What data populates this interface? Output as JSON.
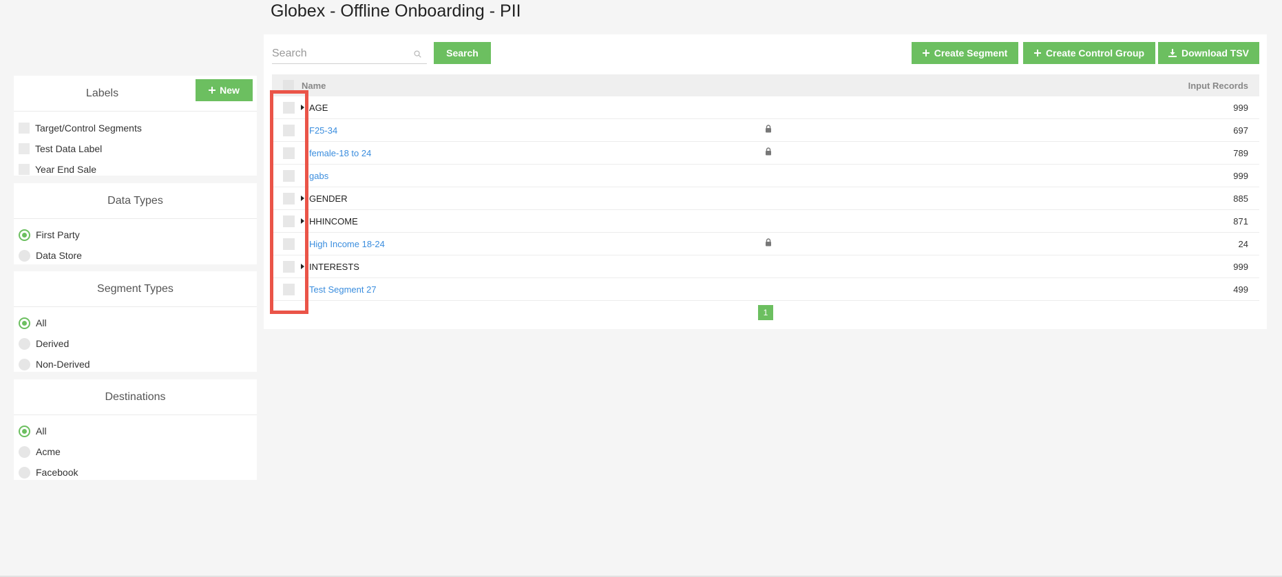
{
  "page": {
    "title": "Globex - Offline Onboarding - PII"
  },
  "labels_panel": {
    "title": "Labels",
    "new_button": "New",
    "items": [
      "Target/Control Segments",
      "Test Data Label",
      "Year End Sale"
    ]
  },
  "data_types_panel": {
    "title": "Data Types",
    "options": [
      {
        "label": "First Party",
        "selected": true
      },
      {
        "label": "Data Store",
        "selected": false
      }
    ]
  },
  "segment_types_panel": {
    "title": "Segment Types",
    "options": [
      {
        "label": "All",
        "selected": true
      },
      {
        "label": "Derived",
        "selected": false
      },
      {
        "label": "Non-Derived",
        "selected": false
      }
    ]
  },
  "destinations_panel": {
    "title": "Destinations",
    "options": [
      {
        "label": "All",
        "selected": true
      },
      {
        "label": "Acme",
        "selected": false
      },
      {
        "label": "Facebook",
        "selected": false
      }
    ]
  },
  "toolbar": {
    "search_placeholder": "Search",
    "search_button": "Search",
    "create_segment": "Create Segment",
    "create_control_group": "Create Control Group",
    "download_tsv": "Download TSV"
  },
  "table": {
    "columns": {
      "name": "Name",
      "input_records": "Input Records"
    },
    "rows": [
      {
        "name": "AGE",
        "records": "999",
        "type": "folder",
        "locked": false
      },
      {
        "name": "F25-34",
        "records": "697",
        "type": "segment",
        "locked": true
      },
      {
        "name": "female-18 to 24",
        "records": "789",
        "type": "segment",
        "locked": true
      },
      {
        "name": "gabs",
        "records": "999",
        "type": "segment",
        "locked": false
      },
      {
        "name": "GENDER",
        "records": "885",
        "type": "folder",
        "locked": false
      },
      {
        "name": "HHINCOME",
        "records": "871",
        "type": "folder",
        "locked": false
      },
      {
        "name": "High Income 18-24",
        "records": "24",
        "type": "segment",
        "locked": true
      },
      {
        "name": "INTERESTS",
        "records": "999",
        "type": "folder",
        "locked": false
      },
      {
        "name": "Test Segment 27",
        "records": "499",
        "type": "segment",
        "locked": false
      }
    ]
  },
  "pagination": {
    "current_page": "1"
  },
  "colors": {
    "accent": "#6cbf60",
    "link": "#3a8dde",
    "highlight": "#ea5448"
  },
  "icons": {
    "new": "plus-icon",
    "search": "magnifier-icon",
    "download": "download-icon",
    "lock": "lock-icon",
    "expand": "caret-right-icon"
  }
}
